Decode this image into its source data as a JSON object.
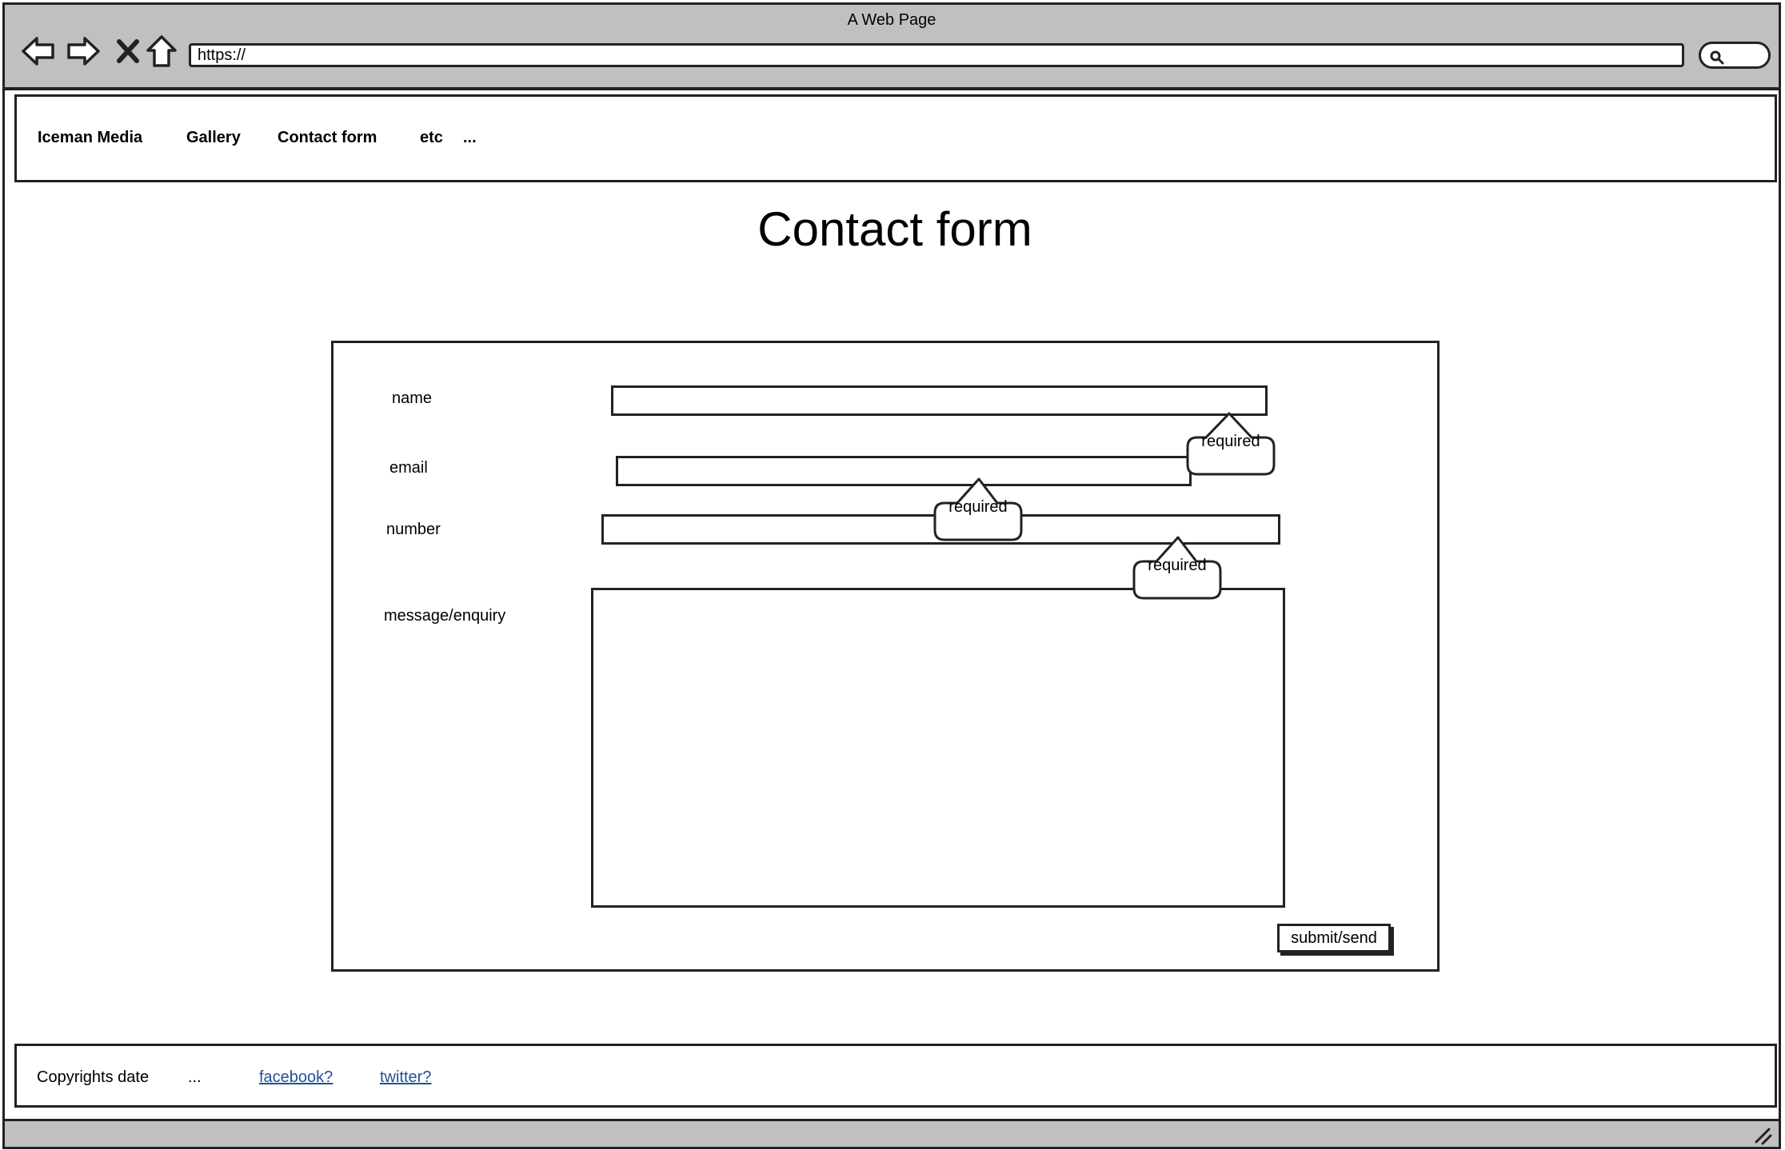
{
  "window": {
    "title": "A Web Page"
  },
  "browser": {
    "url": "https://"
  },
  "nav": {
    "brand": "Iceman Media",
    "items": [
      "Gallery",
      "Contact form",
      "etc",
      "..."
    ]
  },
  "page": {
    "title": "Contact form"
  },
  "form": {
    "fields": [
      {
        "label": "name",
        "value": ""
      },
      {
        "label": "email",
        "value": ""
      },
      {
        "label": "number",
        "value": ""
      },
      {
        "label": "message/enquiry",
        "value": ""
      }
    ],
    "callouts": [
      "required",
      "required",
      "required"
    ],
    "submit_label": "submit/send"
  },
  "footer": {
    "copyright": "Copyrights  date",
    "ellipsis": "...",
    "links": [
      "facebook?",
      "twitter?"
    ]
  },
  "icons": [
    "back-arrow-icon",
    "forward-arrow-icon",
    "close-icon",
    "home-icon",
    "search-icon",
    "resize-grip-icon"
  ]
}
